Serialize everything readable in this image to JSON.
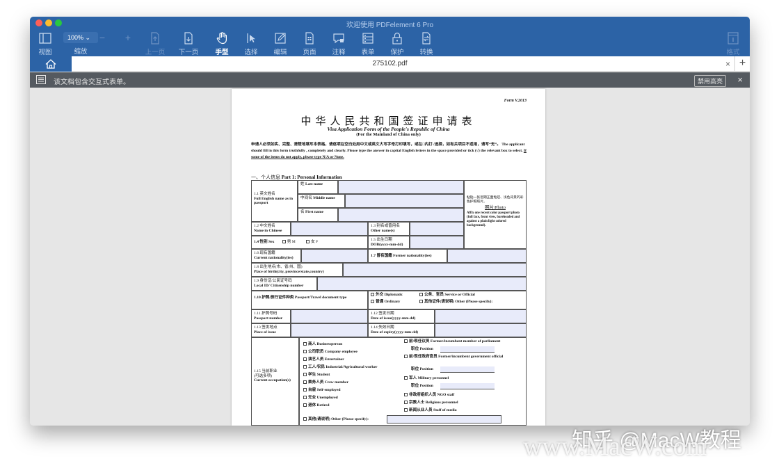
{
  "window": {
    "title": "欢迎使用 PDFelement 6 Pro"
  },
  "toolbar": {
    "view_label": "视图",
    "zoom_value": "100%",
    "zoom_label": "缩放",
    "zoom_out_symbol": "−",
    "zoom_in_symbol": "+",
    "prev_page_label": "上一页",
    "next_page_label": "下一页",
    "hand_label": "手型",
    "select_label": "选择",
    "edit_label": "编辑",
    "page_label": "页面",
    "annotate_label": "注释",
    "form_label": "表单",
    "protect_label": "保护",
    "convert_label": "转换",
    "format_label": "格式"
  },
  "tabs": {
    "filename": "275102.pdf",
    "close_symbol": "×",
    "add_symbol": "+"
  },
  "notice": {
    "text": "该文档包含交互式表单。",
    "disable_label": "禁用高亮",
    "close_symbol": "×"
  },
  "document": {
    "form_no": "Form V.2013",
    "title_cn": "中华人民共和国签证申请表",
    "title_en": "Visa Application Form of the People's Republic of China",
    "subtitle": "(For the Mainland of China only)",
    "instruction_cn": "申请人必须如实、完整、清楚地填写本表格，请逐项在空白处用中文或英文大写字母打印填写，或在□内打√选择，如有关项目不适用，请写“无”。",
    "instruction_en": "The applicant should fill in this form truthfully , completely and clearly. Please type the answer in capital English letters in the space provided or tick (√) the relevant box to select.",
    "instruction_note": "If some of the items do not apply, please type N/A or None.",
    "part1_cn": "一、个人信息",
    "part1_en": "Part 1: Personal Information",
    "fields": {
      "f11_cn": "1.1 英文姓名",
      "f11_en": "Full English name as in passport",
      "last_cn": "姓",
      "last_en": "Last name",
      "middle_cn": "中间名",
      "middle_en": "Middle name",
      "first_cn": "名",
      "first_en": "First name",
      "photo_cn": "粘贴一张近期正面免冠、浅色背景的彩色护照照片。",
      "photo_title": "照片/Photo",
      "photo_en": "Affix one recent color passport photo (full face, front view, bareheaded and against a plain light colored background).",
      "f12_cn": "1.2 中文姓名",
      "f12_en": "Name in Chinese",
      "f13_cn": "1.3 别名或曾用名",
      "f13_en": "Other name(s)",
      "f14": "1.4 性别 Sex",
      "male": "男 M",
      "female": "女 F",
      "f15_cn": "1.5 出生日期",
      "f15_en": "DOB(yyyy-mm-dd)",
      "f16_cn": "1.6 现有国籍",
      "f16_en": "Current nationality(ies)",
      "f17": "1.7 曾有国籍 Former nationality(ies)",
      "f18_cn": "1.8 出生地点(市、省/州、国)",
      "f18_en": "Place of birth(city, province/state,country)",
      "f19_cn": "1.9 身份证/公民证号码",
      "f19_en": "Local ID/ Citizenship number",
      "f110": "1.10 护照/旅行证件种类 Passport/Travel document type",
      "diplomatic": "外交 Diplomatic",
      "service": "公务、官员 Service or Official",
      "ordinary": "普通 Ordinary",
      "other_type": "其他证件(请说明) Other (Please specify):",
      "f111_cn": "1.11 护照号码",
      "f111_en": "Passport number",
      "f112_cn": "1.12 签发日期",
      "f112_en": "Date of issue(yyyy-mm-dd)",
      "f113_cn": "1.13 签发地点",
      "f113_en": "Place of issue",
      "f114_cn": "1.14 失效日期",
      "f114_en": "Date of expiry(yyyy-mm-dd)",
      "f115_cn": "1.15 当前职业",
      "f115_opt": "(可选多项)",
      "f115_en": "Current occupation(s)",
      "occ_left": [
        "商人 Businessperson",
        "公司职员 Company employee",
        "演艺人员 Entertainer",
        "工人/农民 Industrial/Agricultural worker",
        "学生 Student",
        "乘务人员 Crew member",
        "自雇 Self-employed",
        "无业 Unemployed",
        "退休 Retired"
      ],
      "occ_right": [
        "前/现任议员 Former/incumbent member of parliament",
        "职位 Position",
        "前/现任政府官员 Former/incumbent government official",
        "职位 Position",
        "军人 Military personnel",
        "职位 Position",
        "非政府组织人员 NGO staff",
        "宗教人士 Religious personnel",
        "新闻从业人员 Staff of media"
      ],
      "occ_other": "其他(请说明) Other (Please specify):"
    }
  },
  "watermark": {
    "zhihu": "知乎 @MacW教程",
    "site": "www.MacW.com"
  }
}
